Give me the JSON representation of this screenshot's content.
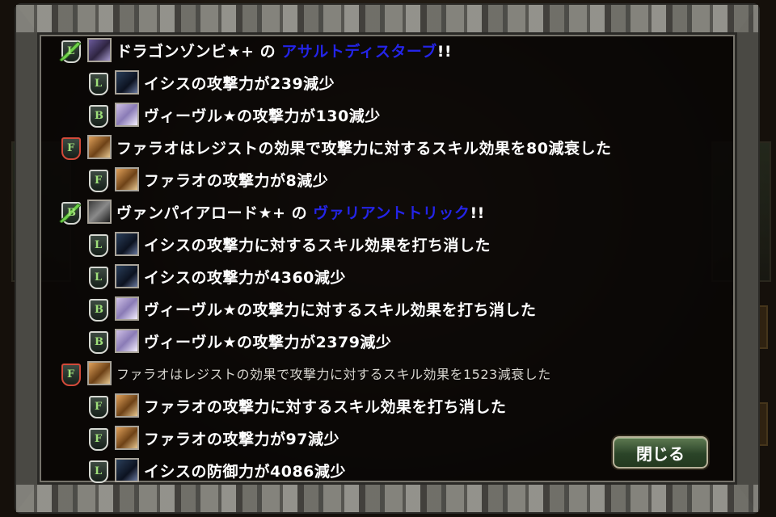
{
  "close_button_label": "閉じる",
  "log": [
    {
      "level": "main",
      "icon": "attack-green",
      "badge": "L",
      "avatar": "drag",
      "parts": [
        {
          "t": "ドラゴンゾンビ★+ の ",
          "c": "normal"
        },
        {
          "t": "アサルトディスターブ",
          "c": "skill"
        },
        {
          "t": "!!",
          "c": "normal"
        }
      ]
    },
    {
      "level": "sub",
      "icon": "shield",
      "badge": "L",
      "avatar": "isis",
      "parts": [
        {
          "t": "イシスの攻撃力が239減少",
          "c": "normal"
        }
      ]
    },
    {
      "level": "sub",
      "icon": "shield",
      "badge": "B",
      "avatar": "viv",
      "parts": [
        {
          "t": "ヴィーヴル★の攻撃力が130減少",
          "c": "normal"
        }
      ]
    },
    {
      "level": "main",
      "icon": "shield-red",
      "badge": "F",
      "avatar": "phar",
      "parts": [
        {
          "t": "ファラオはレジストの効果で攻撃力に対するスキル効果を80減衰した",
          "c": "normal"
        }
      ]
    },
    {
      "level": "sub",
      "icon": "shield",
      "badge": "F",
      "avatar": "phar",
      "parts": [
        {
          "t": "ファラオの攻撃力が8減少",
          "c": "normal"
        }
      ]
    },
    {
      "level": "main",
      "icon": "attack-green",
      "badge": "B",
      "avatar": "vamp",
      "parts": [
        {
          "t": "ヴァンパイアロード★+ の ",
          "c": "normal"
        },
        {
          "t": "ヴァリアントトリック",
          "c": "skill"
        },
        {
          "t": "!!",
          "c": "normal"
        }
      ]
    },
    {
      "level": "sub",
      "icon": "shield",
      "badge": "L",
      "avatar": "isis",
      "parts": [
        {
          "t": "イシスの攻撃力に対するスキル効果を打ち消した",
          "c": "normal"
        }
      ]
    },
    {
      "level": "sub",
      "icon": "shield",
      "badge": "L",
      "avatar": "isis",
      "parts": [
        {
          "t": "イシスの攻撃力が4360減少",
          "c": "normal"
        }
      ]
    },
    {
      "level": "sub",
      "icon": "shield",
      "badge": "B",
      "avatar": "viv",
      "parts": [
        {
          "t": "ヴィーヴル★の攻撃力に対するスキル効果を打ち消した",
          "c": "normal"
        }
      ]
    },
    {
      "level": "sub",
      "icon": "shield",
      "badge": "B",
      "avatar": "viv",
      "parts": [
        {
          "t": "ヴィーヴル★の攻撃力が2379減少",
          "c": "normal"
        }
      ]
    },
    {
      "level": "main",
      "icon": "shield-red",
      "badge": "F",
      "avatar": "phar",
      "style": "dim",
      "parts": [
        {
          "t": "ファラオはレジストの効果で攻撃力に対するスキル効果を1523減衰した",
          "c": "normal"
        }
      ]
    },
    {
      "level": "sub",
      "icon": "shield",
      "badge": "F",
      "avatar": "phar",
      "parts": [
        {
          "t": "ファラオの攻撃力に対するスキル効果を打ち消した",
          "c": "normal"
        }
      ]
    },
    {
      "level": "sub",
      "icon": "shield",
      "badge": "F",
      "avatar": "phar",
      "parts": [
        {
          "t": "ファラオの攻撃力が97減少",
          "c": "normal"
        }
      ]
    },
    {
      "level": "sub",
      "icon": "shield",
      "badge": "L",
      "avatar": "isis",
      "parts": [
        {
          "t": "イシスの防御力が4086減少",
          "c": "normal"
        }
      ]
    }
  ],
  "colors": {
    "skill_name": "#2424e8",
    "text": "#ffffff",
    "badge_green": "#9fe07a",
    "badge_red": "#d24a3a"
  }
}
